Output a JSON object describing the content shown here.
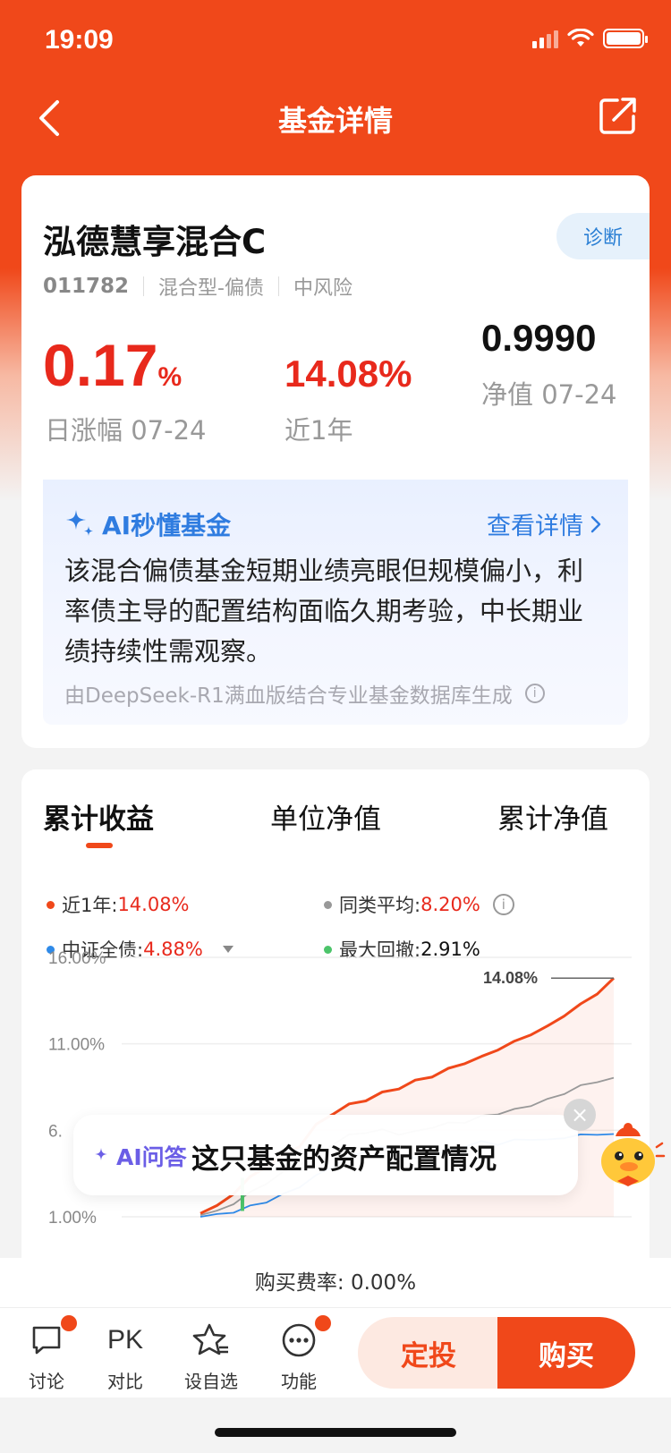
{
  "status_bar": {
    "time": "19:09"
  },
  "nav": {
    "title": "基金详情",
    "back_icon": "chevron-left-icon",
    "share_icon": "share-icon"
  },
  "fund": {
    "name": "泓德慧享混合C",
    "code": "011782",
    "type": "混合型-偏债",
    "risk": "中风险",
    "diagnose_label": "诊断",
    "daily_change": "0.17",
    "daily_change_unit": "%",
    "daily_change_label": "日涨幅 07-24",
    "one_year": "14.08%",
    "one_year_label": "近1年",
    "nav_value": "0.9990",
    "nav_label": "净值 07-24"
  },
  "ai_summary": {
    "title": "AI秒懂基金",
    "more_label": "查看详情",
    "body": "该混合偏债基金短期业绩亮眼但规模偏小，利率债主导的配置结构面临久期考验，中长期业绩持续性需观察。",
    "source": "由DeepSeek-R1满血版结合专业基金数据库生成"
  },
  "chart_tabs": [
    "累计收益",
    "单位净值",
    "累计净值"
  ],
  "legend": {
    "fund": {
      "label": "近1年:",
      "value": "14.08%",
      "color": "#f0481a"
    },
    "peer": {
      "label": "同类平均:",
      "value": "8.20%",
      "color": "#999999"
    },
    "index": {
      "label": "中证全债:",
      "value": "4.88%",
      "color": "#2f8ae8"
    },
    "drawdown": {
      "label": "最大回撤:",
      "value": "2.91%",
      "color": "#4cc46a"
    }
  },
  "chart_data": {
    "type": "line",
    "y_ticks": [
      "16.00%",
      "11.00%",
      "6.",
      "1.00%"
    ],
    "ylim": [
      1,
      16
    ],
    "end_label": "14.08%",
    "series": [
      {
        "name": "近1年",
        "color": "#f0481a",
        "values": [
          0.2,
          0.6,
          1.4,
          2.3,
          3.0,
          3.6,
          4.2,
          5.4,
          6.1,
          6.6,
          6.9,
          7.3,
          7.6,
          8.0,
          8.3,
          8.7,
          9.1,
          9.4,
          9.9,
          10.3,
          10.8,
          11.2,
          11.9,
          12.5,
          13.2,
          14.08
        ]
      },
      {
        "name": "同类平均",
        "color": "#999999",
        "values": [
          0.1,
          0.3,
          0.8,
          1.4,
          2.0,
          2.6,
          3.1,
          3.6,
          4.3,
          4.8,
          5.0,
          5.1,
          4.9,
          5.0,
          5.3,
          5.5,
          5.6,
          5.9,
          6.1,
          6.3,
          6.6,
          6.9,
          7.3,
          7.7,
          8.0,
          8.2
        ]
      },
      {
        "name": "中证全债",
        "color": "#2f8ae8",
        "values": [
          0.0,
          0.1,
          0.3,
          0.6,
          0.9,
          1.3,
          1.8,
          2.4,
          3.0,
          3.5,
          3.9,
          4.1,
          3.8,
          3.4,
          3.6,
          3.9,
          4.2,
          4.4,
          4.3,
          4.5,
          4.6,
          4.5,
          4.7,
          4.8,
          4.9,
          4.88
        ]
      }
    ]
  },
  "ai_ask": {
    "label": "AI问答",
    "query": "这只基金的资产配置情况",
    "close": "×"
  },
  "fee": {
    "text": "购买费率: 0.00%"
  },
  "bottom_bar": {
    "discuss": "讨论",
    "compare_icon_text": "PK",
    "compare": "对比",
    "watchlist": "设自选",
    "more": "功能",
    "invest": "定投",
    "buy": "购买"
  }
}
